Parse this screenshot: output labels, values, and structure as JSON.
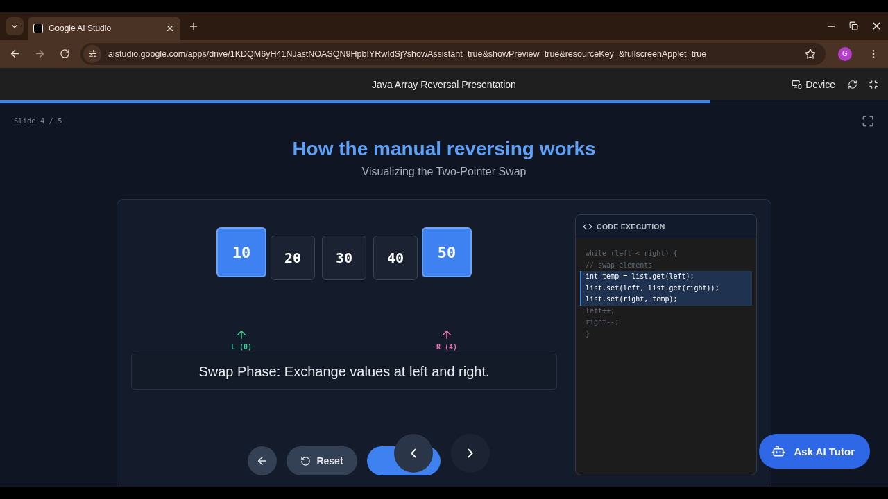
{
  "browser": {
    "tab_title": "Google AI Studio",
    "url": "aistudio.google.com/apps/drive/1KDQM6yH41NJastNOASQN9HpbIYRwIdSj?showAssistant=true&showPreview=true&resourceKey=&fullscreenApplet=true",
    "profile_initial": "G"
  },
  "app_header": {
    "title": "Java Array Reversal Presentation",
    "device_label": "Device",
    "progress": {
      "level": 0.8
    }
  },
  "slide": {
    "counter": "Slide 4 / 5",
    "title": "How the manual reversing works",
    "subtitle": "Visualizing the Two-Pointer Swap",
    "cells": [
      {
        "value": "10",
        "selected": true,
        "pointer": {
          "label": "L (0)",
          "color": "#34d399"
        }
      },
      {
        "value": "20",
        "selected": false
      },
      {
        "value": "30",
        "selected": false
      },
      {
        "value": "40",
        "selected": false
      },
      {
        "value": "50",
        "selected": true,
        "pointer": {
          "label": "R (4)",
          "color": "#f472b6"
        }
      }
    ],
    "message": "Swap Phase: Exchange values at left and right.",
    "controls": {
      "reset_label": "Reset"
    },
    "code_panel": {
      "title": "CODE EXECUTION",
      "lines": [
        {
          "text": "while (left < right) {",
          "highlighted": false
        },
        {
          "text": "// swap elements",
          "highlighted": false
        },
        {
          "text": "int temp = list.get(left);",
          "highlighted": true
        },
        {
          "text": "list.set(left, list.get(right));",
          "highlighted": true
        },
        {
          "text": "list.set(right, temp);",
          "highlighted": true
        },
        {
          "text": "left++;",
          "highlighted": false
        },
        {
          "text": "right--;",
          "highlighted": false
        },
        {
          "text": "}",
          "highlighted": false
        }
      ]
    }
  },
  "tutor_button": {
    "label": "Ask AI Tutor"
  }
}
